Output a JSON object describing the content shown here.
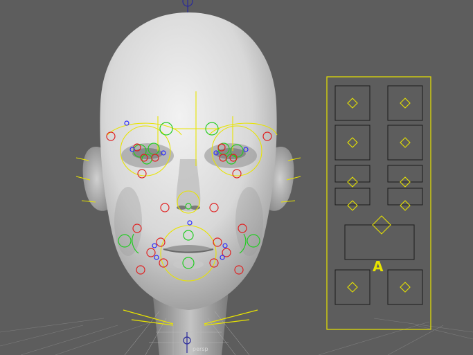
{
  "viewport": {
    "camera_label": "persp",
    "background_color": "#5d5d5d"
  },
  "scene": {
    "head": "head-model",
    "face_rig": {
      "colors": {
        "outline_yellow": "#e8e400",
        "control_red": "#e02020",
        "control_green": "#22cc22",
        "control_blue": "#2a2aff"
      }
    }
  },
  "ui_panel": {
    "label": "A",
    "frame_color": "#e8e400",
    "slider_color": "#1a1a1a"
  }
}
